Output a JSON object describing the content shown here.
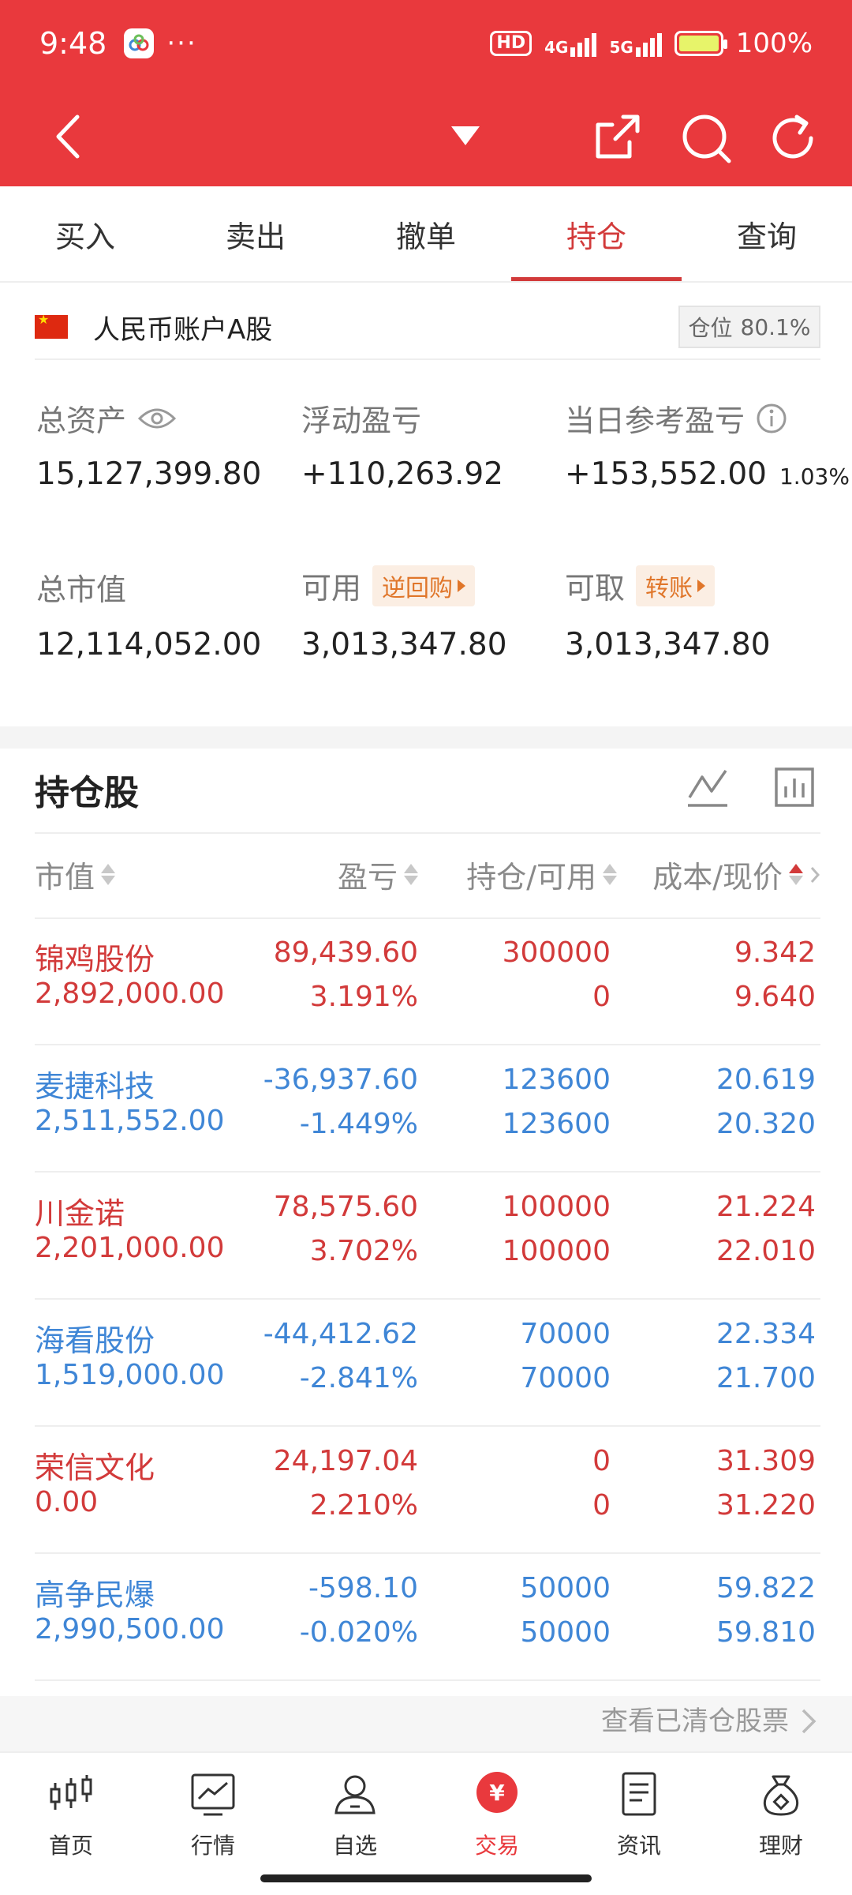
{
  "status": {
    "time": "9:48",
    "dots": "···",
    "hd": "HD",
    "net1": "4G",
    "net2": "5G",
    "battery": "100%"
  },
  "tabs": [
    {
      "label": "买入"
    },
    {
      "label": "卖出"
    },
    {
      "label": "撤单"
    },
    {
      "label": "持仓"
    },
    {
      "label": "查询"
    }
  ],
  "account": {
    "name": "人民币账户A股",
    "position_label": "仓位",
    "position_value": "80.1%"
  },
  "summary": {
    "total_assets_label": "总资产",
    "total_assets": "15,127,399.80",
    "floating_pl_label": "浮动盈亏",
    "floating_pl": "+110,263.92",
    "daily_pl_label": "当日参考盈亏",
    "daily_pl": "+153,552.00",
    "daily_pl_pct": "1.03%",
    "market_value_label": "总市值",
    "market_value": "12,114,052.00",
    "available_label": "可用",
    "available_tag": "逆回购",
    "available": "3,013,347.80",
    "withdrawable_label": "可取",
    "withdrawable_tag": "转账",
    "withdrawable": "3,013,347.80"
  },
  "holdings": {
    "title": "持仓股",
    "columns": [
      "市值",
      "盈亏",
      "持仓/可用",
      "成本/现价"
    ],
    "rows": [
      {
        "name": "锦鸡股份",
        "market_value": "2,892,000.00",
        "pl": "89,439.60",
        "pl_pct": "3.191%",
        "qty": "300000",
        "avail": "0",
        "cost": "9.342",
        "price": "9.640",
        "color": "#d23a3a"
      },
      {
        "name": "麦捷科技",
        "market_value": "2,511,552.00",
        "pl": "-36,937.60",
        "pl_pct": "-1.449%",
        "qty": "123600",
        "avail": "123600",
        "cost": "20.619",
        "price": "20.320",
        "color": "#3f86d6"
      },
      {
        "name": "川金诺",
        "market_value": "2,201,000.00",
        "pl": "78,575.60",
        "pl_pct": "3.702%",
        "qty": "100000",
        "avail": "100000",
        "cost": "21.224",
        "price": "22.010",
        "color": "#d23a3a"
      },
      {
        "name": "海看股份",
        "market_value": "1,519,000.00",
        "pl": "-44,412.62",
        "pl_pct": "-2.841%",
        "qty": "70000",
        "avail": "70000",
        "cost": "22.334",
        "price": "21.700",
        "color": "#3f86d6"
      },
      {
        "name": "荣信文化",
        "market_value": "0.00",
        "pl": "24,197.04",
        "pl_pct": "2.210%",
        "qty": "0",
        "avail": "0",
        "cost": "31.309",
        "price": "31.220",
        "color": "#d23a3a"
      },
      {
        "name": "高争民爆",
        "market_value": "2,990,500.00",
        "pl": "-598.10",
        "pl_pct": "-0.020%",
        "qty": "50000",
        "avail": "50000",
        "cost": "59.822",
        "price": "59.810",
        "color": "#3f86d6"
      }
    ],
    "cleared_link": "查看已清仓股票"
  },
  "bottom_nav": [
    {
      "label": "首页",
      "icon": "candlestick-icon"
    },
    {
      "label": "行情",
      "icon": "market-chart-icon"
    },
    {
      "label": "自选",
      "icon": "user-watchlist-icon"
    },
    {
      "label": "交易",
      "icon": "yuan-trade-icon"
    },
    {
      "label": "资讯",
      "icon": "news-document-icon"
    },
    {
      "label": "理财",
      "icon": "money-bag-icon"
    }
  ],
  "colors": {
    "brand_red": "#e9393d",
    "up_red": "#d23a3a",
    "down_blue": "#3f86d6",
    "tag_orange": "#e0762a"
  }
}
